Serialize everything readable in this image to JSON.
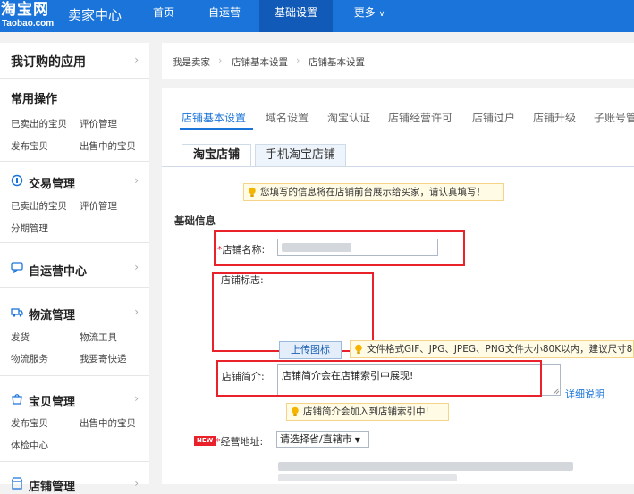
{
  "header": {
    "logo_text": "淘宝网",
    "logo_subtext": "Taobao.com",
    "app_title": "卖家中心",
    "nav": [
      {
        "label": "首页"
      },
      {
        "label": "自运营"
      },
      {
        "label": "基础设置"
      },
      {
        "label": "更多"
      }
    ],
    "active_nav": "基础设置"
  },
  "sidebar": {
    "top_title": "我订购的应用",
    "sections": [
      {
        "title": "常用操作",
        "links": [
          "已卖出的宝贝",
          "评价管理",
          "发布宝贝",
          "出售中的宝贝"
        ]
      },
      {
        "title": "交易管理",
        "icon": "transaction-icon",
        "links": [
          "已卖出的宝贝",
          "评价管理",
          "分期管理"
        ]
      },
      {
        "title": "自运营中心",
        "icon": "chat-icon",
        "links": []
      },
      {
        "title": "物流管理",
        "icon": "logistics-icon",
        "links": [
          "发货",
          "物流工具",
          "物流服务",
          "我要寄快递"
        ]
      },
      {
        "title": "宝贝管理",
        "icon": "goods-icon",
        "links": [
          "发布宝贝",
          "出售中的宝贝",
          "体检中心"
        ]
      },
      {
        "title": "店铺管理",
        "icon": "shop-icon",
        "links": []
      }
    ]
  },
  "breadcrumb": [
    "我是卖家",
    "店铺基本设置",
    "店铺基本设置"
  ],
  "tabs_primary": [
    "店铺基本设置",
    "域名设置",
    "淘宝认证",
    "店铺经营许可",
    "店铺过户",
    "店铺升级",
    "子账号管"
  ],
  "tabs_secondary": [
    "淘宝店铺",
    "手机淘宝店铺"
  ],
  "form": {
    "top_tip": "您填写的信息将在店铺前台展示给买家，请认真填写！",
    "section_title": "基础信息",
    "shop_name_label": "店铺名称:",
    "shop_logo_label": "店铺标志:",
    "upload_button": "上传图标",
    "logo_tip": "文件格式GIF、JPG、JPEG、PNG文件大小80K以内，建议尺寸8",
    "intro_label": "店铺简介:",
    "intro_value": "店铺简介会在店铺索引中展现!",
    "detail_link": "详细说明",
    "intro_tip": "店铺简介会加入到店铺索引中!",
    "new_badge": "NEW",
    "address_label": "经营地址:",
    "address_select": "请选择省/直辖市"
  },
  "colors": {
    "brand_blue": "#1a74d9",
    "highlight_red": "#e8212b",
    "tip_background": "#fffbe5"
  }
}
